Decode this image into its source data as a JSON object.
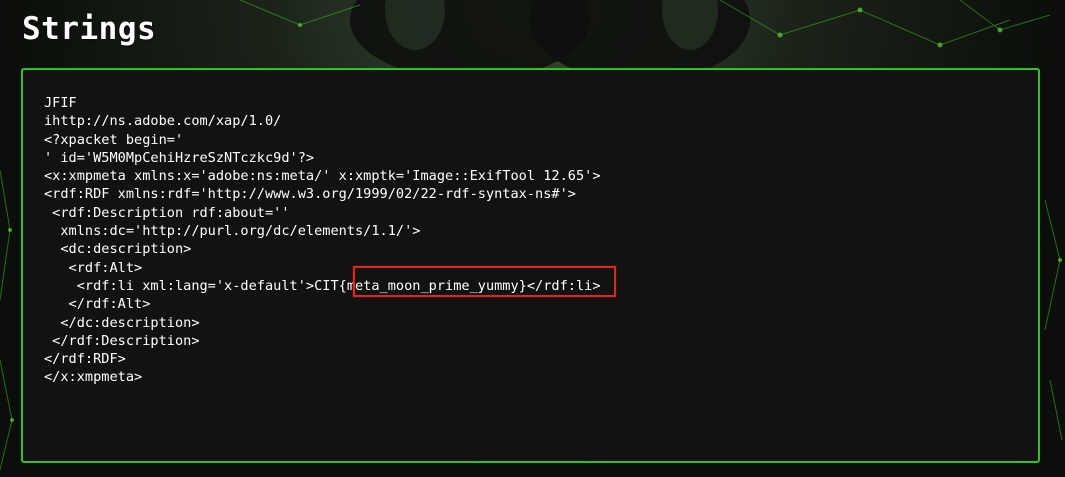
{
  "page": {
    "title": "Strings"
  },
  "strings_panel": {
    "lines": [
      "JFIF",
      "ihttp://ns.adobe.com/xap/1.0/",
      "<?xpacket begin='",
      "' id='W5M0MpCehiHzreSzNTczkc9d'?>",
      "<x:xmpmeta xmlns:x='adobe:ns:meta/' x:xmptk='Image::ExifTool 12.65'>",
      "<rdf:RDF xmlns:rdf='http://www.w3.org/1999/02/22-rdf-syntax-ns#'>",
      " <rdf:Description rdf:about=''",
      "  xmlns:dc='http://purl.org/dc/elements/1.1/'>",
      "  <dc:description>",
      "   <rdf:Alt>",
      "    <rdf:li xml:lang='x-default'>CIT{meta_moon_prime_yummy}</rdf:li>",
      "   </rdf:Alt>",
      "  </dc:description>",
      " </rdf:Description>",
      "</rdf:RDF>",
      "</x:xmpmeta>"
    ],
    "highlight_text": "CIT{meta_moon_prime_yummy}",
    "highlight_color": "#e0251c",
    "border_color": "#2fc41d"
  }
}
